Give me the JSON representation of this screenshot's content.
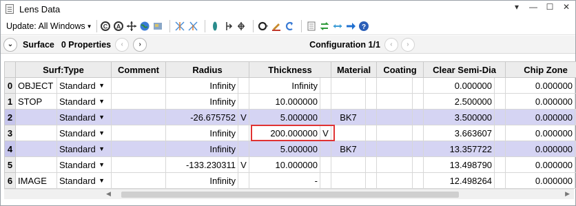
{
  "window": {
    "title": "Lens Data"
  },
  "toolbar": {
    "update_label": "Update: All Windows"
  },
  "header": {
    "surface_label": "Surface",
    "properties_label": "0 Properties",
    "config_label": "Configuration 1/1"
  },
  "columns": [
    "Surf:Type",
    "Comment",
    "Radius",
    "Thickness",
    "Material",
    "Coating",
    "Clear Semi-Dia",
    "Chip Zone"
  ],
  "rows": [
    {
      "num": "0",
      "name": "OBJECT",
      "type": "Standard",
      "comment": "",
      "radius": "Infinity",
      "radius_flag": "",
      "thickness": "Infinity",
      "thickness_flag": "",
      "material": "",
      "coating": "",
      "semi_dia": "0.000000",
      "chip": "0.000000"
    },
    {
      "num": "1",
      "name": "STOP",
      "type": "Standard",
      "comment": "",
      "radius": "Infinity",
      "radius_flag": "",
      "thickness": "10.000000",
      "thickness_flag": "",
      "material": "",
      "coating": "",
      "semi_dia": "2.500000",
      "chip": "0.000000"
    },
    {
      "num": "2",
      "name": "",
      "type": "Standard",
      "comment": "",
      "radius": "-26.675752",
      "radius_flag": "V",
      "thickness": "5.000000",
      "thickness_flag": "",
      "material": "BK7",
      "coating": "",
      "semi_dia": "3.500000",
      "chip": "0.000000"
    },
    {
      "num": "3",
      "name": "",
      "type": "Standard",
      "comment": "",
      "radius": "Infinity",
      "radius_flag": "",
      "thickness": "200.000000",
      "thickness_flag": "V",
      "material": "",
      "coating": "",
      "semi_dia": "3.663607",
      "chip": "0.000000"
    },
    {
      "num": "4",
      "name": "",
      "type": "Standard",
      "comment": "",
      "radius": "Infinity",
      "radius_flag": "",
      "thickness": "5.000000",
      "thickness_flag": "",
      "material": "BK7",
      "coating": "",
      "semi_dia": "13.357722",
      "chip": "0.000000"
    },
    {
      "num": "5",
      "name": "",
      "type": "Standard",
      "comment": "",
      "radius": "-133.230311",
      "radius_flag": "V",
      "thickness": "10.000000",
      "thickness_flag": "",
      "material": "",
      "coating": "",
      "semi_dia": "13.498790",
      "chip": "0.000000"
    },
    {
      "num": "6",
      "name": "IMAGE",
      "type": "Standard",
      "comment": "",
      "radius": "Infinity",
      "radius_flag": "",
      "thickness": "-",
      "thickness_flag": "",
      "material": "",
      "coating": "",
      "semi_dia": "12.498264",
      "chip": "0.000000"
    }
  ],
  "selected_rows": [
    2,
    4
  ],
  "colors": {
    "selection": "#d5d4f3",
    "highlight_box": "#e03232"
  }
}
